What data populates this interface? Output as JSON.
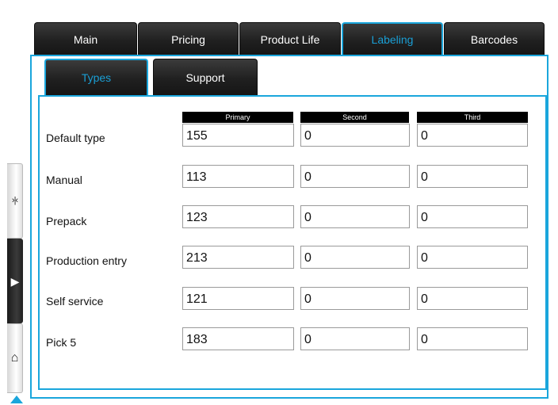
{
  "main_tabs": [
    {
      "label": "Main"
    },
    {
      "label": "Pricing"
    },
    {
      "label": "Product Life"
    },
    {
      "label": "Labeling",
      "active": true
    },
    {
      "label": "Barcodes"
    }
  ],
  "sub_tabs": [
    {
      "label": "Types",
      "active": true
    },
    {
      "label": "Support"
    }
  ],
  "columns": {
    "primary": "Primary",
    "second": "Second",
    "third": "Third"
  },
  "rows": [
    {
      "label": "Default type",
      "primary": "155",
      "second": "0",
      "third": "0"
    },
    {
      "label": "Manual",
      "primary": "113",
      "second": "0",
      "third": "0"
    },
    {
      "label": "Prepack",
      "primary": "123",
      "second": "0",
      "third": "0"
    },
    {
      "label": "Production entry",
      "primary": "213",
      "second": "0",
      "third": "0"
    },
    {
      "label": "Self service",
      "primary": "121",
      "second": "0",
      "third": "0"
    },
    {
      "label": "Pick 5",
      "primary": "183",
      "second": "0",
      "third": "0"
    }
  ],
  "rail_icons": [
    "collapse-icon",
    "play-icon",
    "home-icon"
  ],
  "accent_color": "#1aa6dc"
}
